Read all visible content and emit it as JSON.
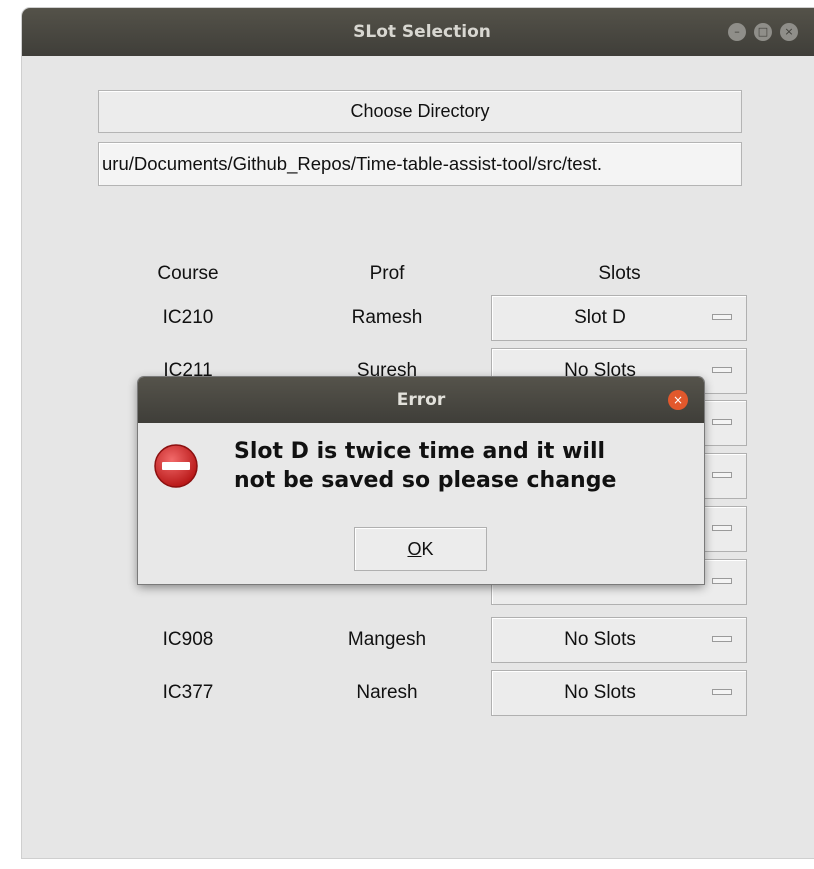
{
  "window": {
    "title": "SLot Selection",
    "controls": {
      "minimize": "–",
      "maximize": "□",
      "close": "×"
    }
  },
  "directory": {
    "button_label": "Choose Directory",
    "path_value": "uru/Documents/Github_Repos/Time-table-assist-tool/src/test."
  },
  "table": {
    "headers": {
      "course": "Course",
      "prof": "Prof",
      "slots": "Slots"
    },
    "rows": [
      {
        "course": "IC210",
        "prof": "Ramesh",
        "slot": "Slot D"
      },
      {
        "course": "IC211",
        "prof": "Suresh",
        "slot": "No Slots"
      },
      {
        "course": "",
        "prof": "",
        "slot": ""
      },
      {
        "course": "",
        "prof": "",
        "slot": ""
      },
      {
        "course": "",
        "prof": "",
        "slot": ""
      },
      {
        "course": "",
        "prof": "",
        "slot": ""
      },
      {
        "course": "IC908",
        "prof": "Mangesh",
        "slot": "No Slots"
      },
      {
        "course": "IC377",
        "prof": "Naresh",
        "slot": "No Slots"
      }
    ]
  },
  "error_dialog": {
    "title": "Error",
    "close": "×",
    "message_line1": "Slot D is twice time and it will",
    "message_line2": "not be saved so please change",
    "ok_mnemonic": "O",
    "ok_rest": "K"
  },
  "colors": {
    "titlebar": "#3f3e39",
    "window_bg": "#e6e6e6",
    "dialog_close": "#e2582c",
    "error_icon": "#d42b2b"
  }
}
